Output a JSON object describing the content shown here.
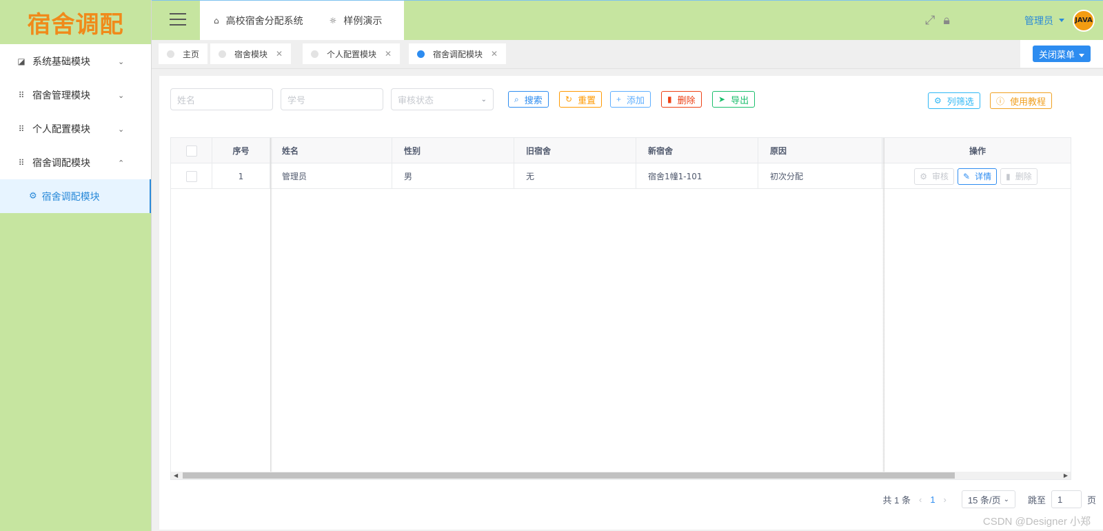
{
  "app": {
    "logo_text": "宿舍调配"
  },
  "sidebar": {
    "items": [
      {
        "label": "系统基础模块",
        "icon": "chart-icon",
        "arrow": "⌄"
      },
      {
        "label": "宿舍管理模块",
        "icon": "grid-icon",
        "arrow": "⌄"
      },
      {
        "label": "个人配置模块",
        "icon": "grid-icon",
        "arrow": "⌄"
      },
      {
        "label": "宿舍调配模块",
        "icon": "grid-icon",
        "arrow": "⌃"
      }
    ],
    "subitem": {
      "label": "宿舍调配模块",
      "icon": "gear-icon"
    }
  },
  "header": {
    "tabs": [
      {
        "label": "高校宿舍分配系统",
        "icon": "home-icon"
      },
      {
        "label": "样例演示",
        "icon": "bulb-icon"
      }
    ],
    "user": {
      "name": "管理员",
      "avatar_text": "JAVA"
    }
  },
  "page_tabs": [
    {
      "label": "主页",
      "closable": false,
      "active": false
    },
    {
      "label": "宿舍模块",
      "closable": true,
      "active": false
    },
    {
      "label": "个人配置模块",
      "closable": true,
      "active": false
    },
    {
      "label": "宿舍调配模块",
      "closable": true,
      "active": true
    }
  ],
  "close_menu_label": "关闭菜单",
  "filters": {
    "name_placeholder": "姓名",
    "student_id_placeholder": "学号",
    "status_placeholder": "审核状态"
  },
  "toolbar": {
    "search": "搜索",
    "reset": "重置",
    "add": "添加",
    "delete": "删除",
    "export": "导出",
    "column_filter": "列筛选",
    "tutorial": "使用教程"
  },
  "table": {
    "columns": [
      "序号",
      "姓名",
      "性别",
      "旧宿舍",
      "新宿舍",
      "原因",
      "操作"
    ],
    "rows": [
      {
        "index": "1",
        "name": "管理员",
        "gender": "男",
        "old_dorm": "无",
        "new_dorm": "宿舍1幢1-101",
        "reason": "初次分配"
      }
    ],
    "actions": {
      "review": "审核",
      "detail": "详情",
      "delete": "删除"
    }
  },
  "pagination": {
    "total": "共 1 条",
    "current_page": "1",
    "page_size": "15 条/页",
    "jump_label": "跳至",
    "jump_value": "1",
    "page_suffix": "页"
  },
  "watermark": "CSDN @Designer 小郑"
}
